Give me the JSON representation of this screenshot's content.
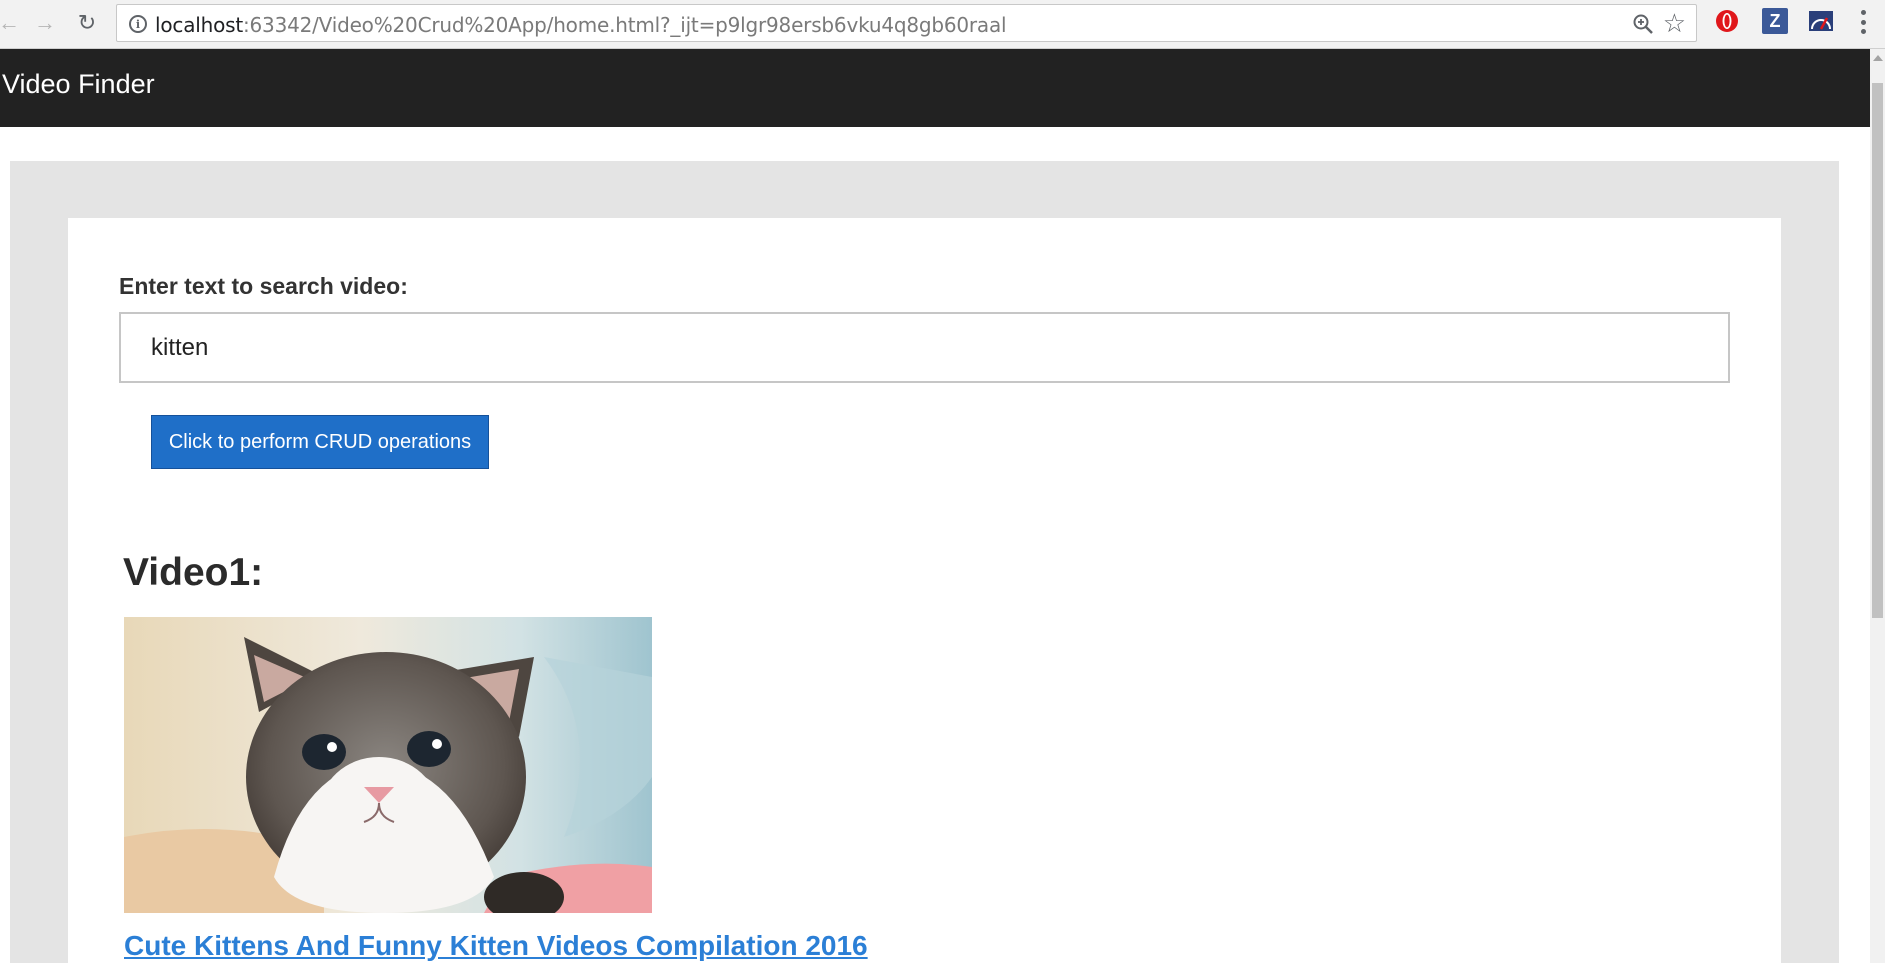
{
  "browser": {
    "url_host": "localhost",
    "url_rest": ":63342/Video%20Crud%20App/home.html?_ijt=p9lgr98ersb6vku4q8gb60raal",
    "extension_z_label": "Z"
  },
  "app": {
    "title": "Video Finder"
  },
  "search": {
    "label": "Enter text to search video:",
    "value": "kitten",
    "button_label": "Click to perform CRUD operations"
  },
  "videos": [
    {
      "heading": "Video1:",
      "title": "Cute Kittens And Funny Kitten Videos Compilation 2016",
      "thumbnail": "kitten-thumbnail"
    }
  ],
  "colors": {
    "header_bg": "#222222",
    "panel_bg": "#e4e4e4",
    "button_bg": "#1f6fc8",
    "link": "#2b7fd6"
  }
}
